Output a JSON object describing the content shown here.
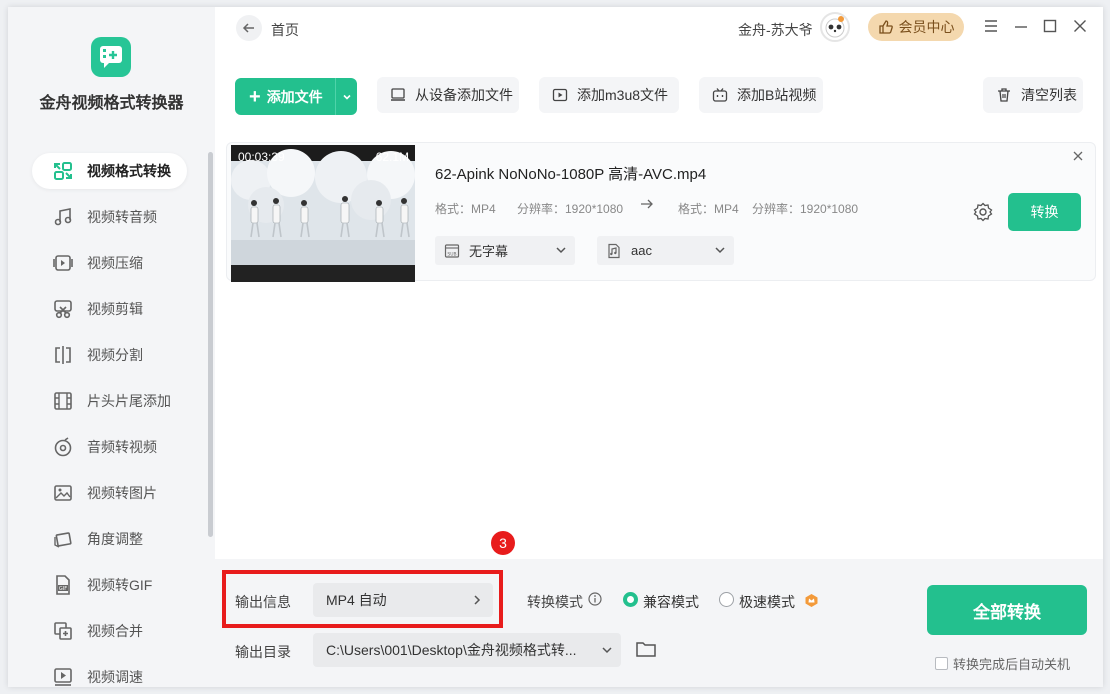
{
  "app": {
    "title": "金舟视频格式转换器",
    "accent": "#23c08e",
    "highlight": "#e81c1c"
  },
  "sidebar": {
    "items": [
      {
        "label": "视频格式转换",
        "icon": "format-convert-icon",
        "active": true
      },
      {
        "label": "视频转音频",
        "icon": "music-note-icon"
      },
      {
        "label": "视频压缩",
        "icon": "compress-icon"
      },
      {
        "label": "视频剪辑",
        "icon": "scissors-icon"
      },
      {
        "label": "视频分割",
        "icon": "split-icon"
      },
      {
        "label": "片头片尾添加",
        "icon": "film-strip-icon"
      },
      {
        "label": "音频转视频",
        "icon": "disc-icon"
      },
      {
        "label": "视频转图片",
        "icon": "image-icon"
      },
      {
        "label": "角度调整",
        "icon": "rotate-icon"
      },
      {
        "label": "视频转GIF",
        "icon": "gif-file-icon"
      },
      {
        "label": "视频合并",
        "icon": "merge-icon"
      },
      {
        "label": "视频调速",
        "icon": "speed-icon"
      }
    ]
  },
  "header": {
    "breadcrumb": "首页",
    "username": "金舟-苏大爷",
    "vip_label": "会员中心"
  },
  "toolbar": {
    "add_file": "添加文件",
    "add_from_device": "从设备添加文件",
    "add_m3u8": "添加m3u8文件",
    "add_bilibili": "添加B站视频",
    "clear_list": "清空列表"
  },
  "file": {
    "duration": "00:03:39",
    "size": "62.1M",
    "name": "62-Apink NoNoNo-1080P 高清-AVC.mp4",
    "src_format": "格式：MP4",
    "src_resolution": "分辨率：1920*1080",
    "dst_format": "格式：MP4",
    "dst_resolution": "分辨率：1920*1080",
    "subtitle": "无字幕",
    "audio": "aac",
    "convert_label": "转换"
  },
  "output": {
    "info_label": "输出信息",
    "info_value": "MP4 自动",
    "dir_label": "输出目录",
    "dir_value": "C:\\Users\\001\\Desktop\\金舟视频格式转...",
    "mode_label": "转换模式",
    "mode_compatible": "兼容模式",
    "mode_fast": "极速模式",
    "selected_mode": "兼容模式",
    "convert_all": "全部转换",
    "auto_shutdown": "转换完成后自动关机",
    "auto_shutdown_checked": false
  },
  "annotation": {
    "step": "3"
  }
}
